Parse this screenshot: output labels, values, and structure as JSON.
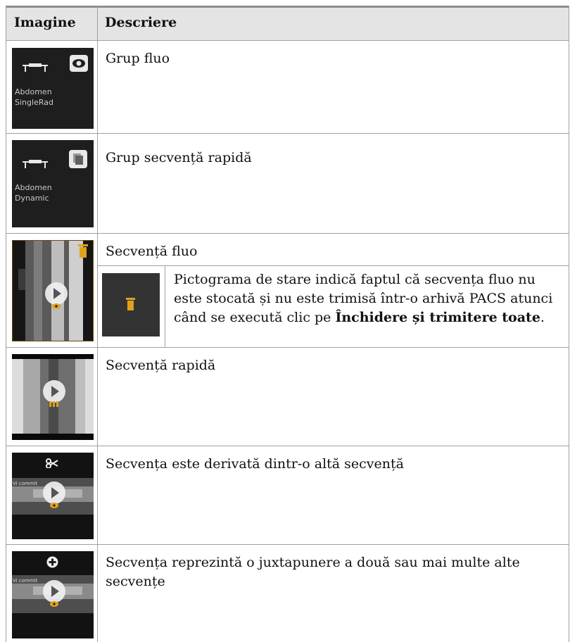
{
  "table": {
    "headers": {
      "image": "Imagine",
      "description": "Descriere"
    },
    "rows": [
      {
        "thumb_icon": "eye-icon",
        "thumb_lines": [
          "Abdomen",
          "SingleRad"
        ],
        "description": "Grup fluo"
      },
      {
        "thumb_icon": "stack-icon",
        "thumb_lines": [
          "Abdomen",
          "Dynamic"
        ],
        "description": "Grup secvență rapidă"
      },
      {
        "thumb_icon": "trash-icon",
        "description": "Secvență fluo",
        "sub": {
          "icon": "trash-icon",
          "text_before": "Pictograma de stare indică faptul că secvența fluo nu este stocată și nu este trimisă într-o arhivă PACS atunci când se execută clic pe ",
          "bold": "Închidere și trimitere toate",
          "text_after": "."
        }
      },
      {
        "thumb_icon": "play-icon",
        "description": "Secvență rapidă"
      },
      {
        "thumb_icon": "scissors-icon",
        "thumb_caption": "Vi commit",
        "description": "Secvența este derivată dintr-o altă secvență"
      },
      {
        "thumb_icon": "plus-icon",
        "thumb_caption": "Vi commit",
        "description": "Secvența reprezintă o juxtapunere a două sau mai multe alte secvențe"
      }
    ]
  },
  "colors": {
    "header_bg": "#e4e4e4",
    "border": "#a0a0a0",
    "thumb_bg": "#1e1e1e",
    "status_orange": "#e0a21c"
  }
}
